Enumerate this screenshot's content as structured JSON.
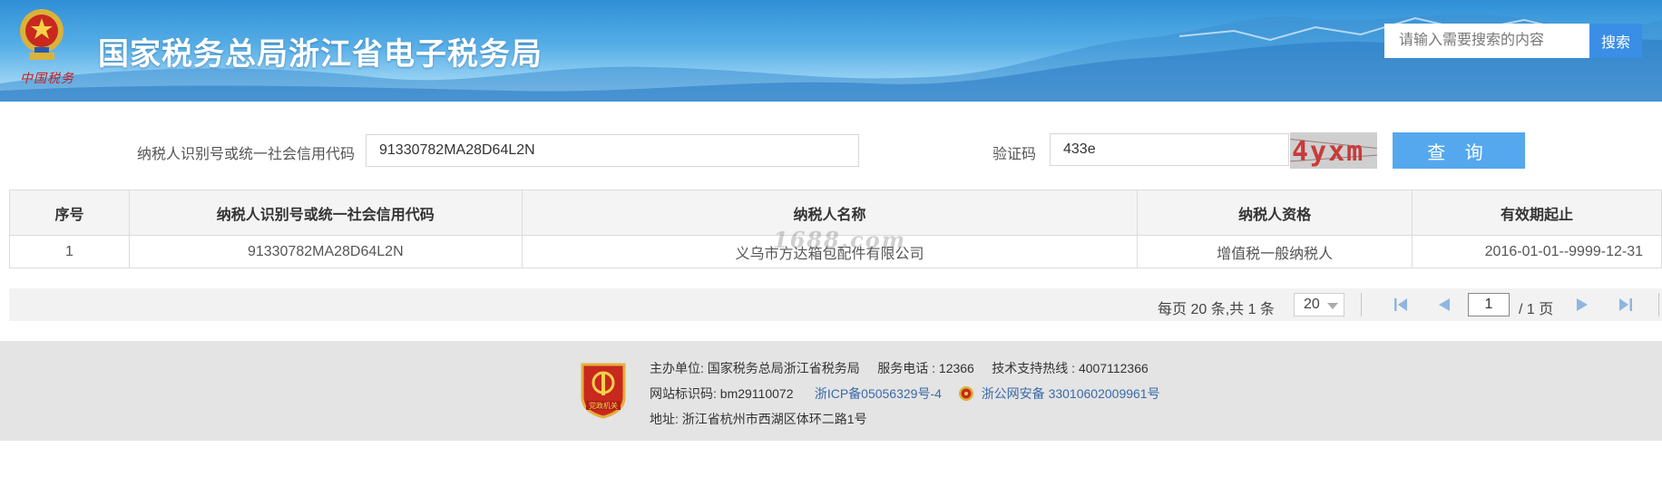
{
  "header": {
    "logo_signature": "中国税务",
    "title": "国家税务总局浙江省电子税务局",
    "search_placeholder": "请输入需要搜索的内容",
    "search_button": "搜索"
  },
  "query": {
    "taxpayer_id_label": "纳税人识别号或统一社会信用代码",
    "taxpayer_id_value": "91330782MA28D64L2N",
    "captcha_label": "验证码",
    "captcha_value": "433e",
    "captcha_image_text": "4yxm",
    "submit_label": "查 询"
  },
  "table": {
    "columns": [
      "序号",
      "纳税人识别号或统一社会信用代码",
      "纳税人名称",
      "纳税人资格",
      "有效期起止"
    ],
    "rows": [
      [
        "1",
        "91330782MA28D64L2N",
        "义乌市方达箱包配件有限公司",
        "增值税一般纳税人",
        "2016-01-01--9999-12-31"
      ]
    ],
    "watermark": "1688.com"
  },
  "pager": {
    "summary": "每页 20 条,共 1 条",
    "page_size": "20",
    "current_page": "1",
    "total_pages": "/ 1 页"
  },
  "footer": {
    "host_label": "主办单位:",
    "host_value": "国家税务总局浙江省税务局",
    "service_phone": "服务电话 : 12366",
    "support_phone": "技术支持热线 : 4007112366",
    "site_code": "网站标识码: bm29110072",
    "icp": "浙ICP备05056329号-4",
    "police_record": "浙公网安备 33010602009961号",
    "address": "地址: 浙江省杭州市西湖区体环二路1号",
    "badge_text": "党政机关"
  },
  "colors": {
    "header_blue": "#2f8fd6",
    "search_button": "#3a8ee6",
    "query_button": "#55a8ee",
    "footer_bg": "#e4e4e4",
    "link": "#3a6aa8"
  },
  "icons": [
    "national-tax-emblem-icon",
    "first-page-icon",
    "prev-page-icon",
    "next-page-icon",
    "last-page-icon",
    "party-government-badge-icon",
    "police-badge-icon"
  ]
}
